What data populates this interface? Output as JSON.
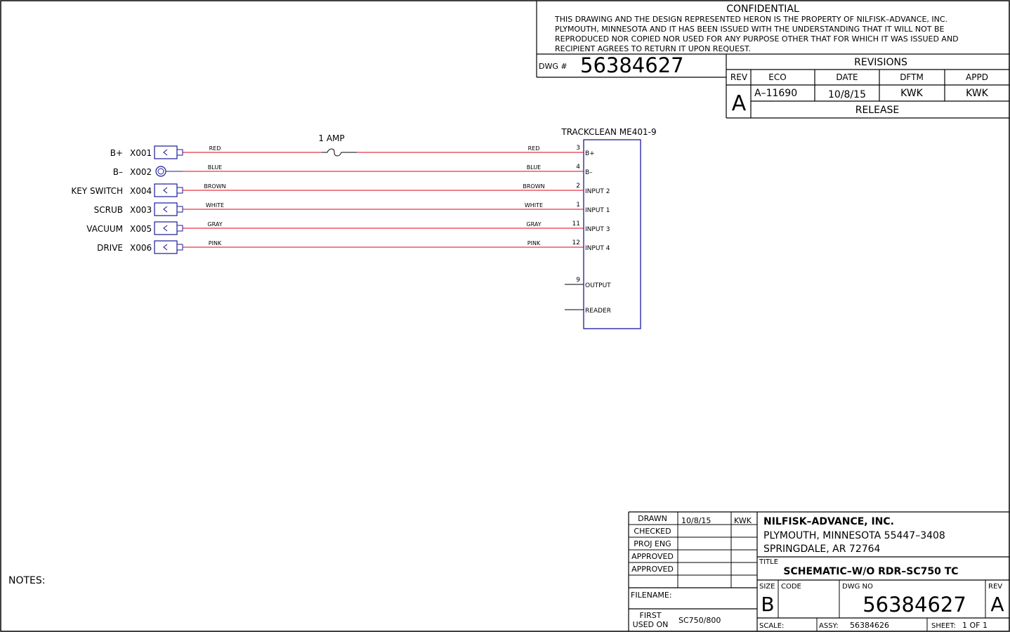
{
  "confidential": {
    "heading": "CONFIDENTIAL",
    "lines": [
      "THIS DRAWING AND THE DESIGN REPRESENTED HERON IS THE PROPERTY OF NILFISK–ADVANCE, INC.",
      "PLYMOUTH, MINNESOTA AND IT HAS BEEN ISSUED WITH THE UNDERSTANDING THAT IT WILL NOT BE",
      "REPRODUCED NOR COPIED NOR USED FOR ANY PURPOSE OTHER THAT FOR WHICH IT WAS ISSUED AND",
      "RECIPIENT AGREES TO RETURN IT UPON REQUEST."
    ],
    "dwg_label": "DWG #",
    "dwg_number": "56384627"
  },
  "revisions": {
    "title": "REVISIONS",
    "headers": [
      "REV",
      "ECO",
      "DATE",
      "DFTM",
      "APPD"
    ],
    "rev": "A",
    "eco": "A–11690",
    "date": "10/8/15",
    "dftm": "KWK",
    "appd": "KWK",
    "description": "RELEASE"
  },
  "fuse_label": "1 AMP",
  "module": {
    "title": "TRACKCLEAN ME401-9",
    "pins": [
      {
        "num": "3",
        "label": "B+"
      },
      {
        "num": "4",
        "label": "B–"
      },
      {
        "num": "2",
        "label": "INPUT 2"
      },
      {
        "num": "1",
        "label": "INPUT 1"
      },
      {
        "num": "11",
        "label": "INPUT 3"
      },
      {
        "num": "12",
        "label": "INPUT 4"
      },
      {
        "num": "9",
        "label": "OUTPUT"
      },
      {
        "num": "",
        "label": "READER"
      }
    ]
  },
  "connectors": [
    {
      "name": "B+",
      "ref": "X001",
      "wire": "RED",
      "type": "plug"
    },
    {
      "name": "B–",
      "ref": "X002",
      "wire": "BLUE",
      "type": "ring"
    },
    {
      "name": "KEY SWITCH",
      "ref": "X004",
      "wire": "BROWN",
      "type": "plug"
    },
    {
      "name": "SCRUB",
      "ref": "X003",
      "wire": "WHITE",
      "type": "plug"
    },
    {
      "name": "VACUUM",
      "ref": "X005",
      "wire": "GRAY",
      "type": "plug"
    },
    {
      "name": "DRIVE",
      "ref": "X006",
      "wire": "PINK",
      "type": "plug"
    }
  ],
  "notes_label": "NOTES:",
  "title_block": {
    "rows": [
      {
        "label": "DRAWN",
        "date": "10/8/15",
        "init": "KWK"
      },
      {
        "label": "CHECKED",
        "date": "",
        "init": ""
      },
      {
        "label": "PROJ ENG",
        "date": "",
        "init": ""
      },
      {
        "label": "APPROVED",
        "date": "",
        "init": ""
      },
      {
        "label": "APPROVED",
        "date": "",
        "init": ""
      }
    ],
    "filename_label": "FILENAME:",
    "first_used_label_1": "FIRST",
    "first_used_label_2": "USED ON",
    "first_used": "SC750/800",
    "company": "NILFISK–ADVANCE, INC.",
    "address_1": "PLYMOUTH, MINNESOTA 55447–3408",
    "address_2": "SPRINGDALE, AR 72764",
    "title_label": "TITLE",
    "title": "SCHEMATIC–W/O RDR–SC750 TC",
    "size_label": "SIZE",
    "size": "B",
    "code_label": "CODE",
    "dwg_no_label": "DWG NO",
    "dwg_no": "56384627",
    "rev_label": "REV",
    "rev": "A",
    "scale_label": "SCALE:",
    "assy_label": "ASSY:",
    "assy": "56384626",
    "sheet_label": "SHEET:",
    "sheet": "1 OF 1"
  },
  "colors": {
    "wire": "#e0001a",
    "connector": "#1a1a99",
    "module": "#1a1a99",
    "line": "#000000"
  }
}
